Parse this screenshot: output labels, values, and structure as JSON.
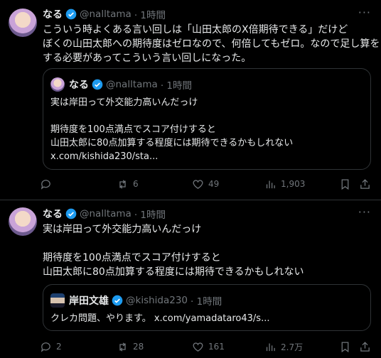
{
  "tweets": [
    {
      "name": "なる",
      "handle": "@nalltama",
      "time": "· 1時間",
      "text": [
        "こういう時よくある言い回しは「山田太郎のX倍期待できる」だけど",
        "ぼくの山田太郎への期待度はゼロなので、何倍してもゼロ。なので足し算を",
        "する必要があってこういう言い回しになった。"
      ],
      "quote": {
        "name": "なる",
        "handle": "@nalltama",
        "time": "· 1時間",
        "text": [
          "実は岸田って外交能力高いんだっけ",
          "",
          "期待度を100点満点でスコア付けすると",
          "山田太郎に80点加算する程度には期待できるかもしれない",
          "x.com/kishida230/sta..."
        ]
      },
      "actions": {
        "replies": "",
        "reposts": "6",
        "likes": "49",
        "views": "1,903"
      }
    },
    {
      "name": "なる",
      "handle": "@nalltama",
      "time": "· 1時間",
      "text": [
        "実は岸田って外交能力高いんだっけ",
        "",
        "期待度を100点満点でスコア付けすると",
        "山田太郎に80点加算する程度には期待できるかもしれない"
      ],
      "quote": {
        "name": "岸田文雄",
        "handle": "@kishida230",
        "time": "· 1時間",
        "text": [
          "クレカ問題、やります。 x.com/yamadataro43/s..."
        ]
      },
      "actions": {
        "replies": "2",
        "reposts": "28",
        "likes": "161",
        "views": "2.7万"
      }
    }
  ],
  "more_label": "···",
  "colors": {
    "background": "#000000",
    "text": "#e7e9ea",
    "muted": "#71767b",
    "border": "#2f3336",
    "verified": "#1d9bf0"
  }
}
